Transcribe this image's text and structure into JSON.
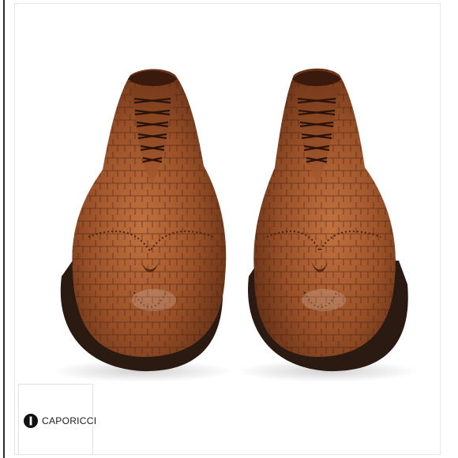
{
  "brand": {
    "name": "CAPORICCI",
    "logo_icon": "caporicci-logo-icon"
  },
  "product": {
    "image_icon": "shoe-pair-photo",
    "colors": {
      "leather": "#8a4a26",
      "leather_light": "#b86a3a",
      "sole": "#2a1a12",
      "background": "#ffffff"
    }
  }
}
